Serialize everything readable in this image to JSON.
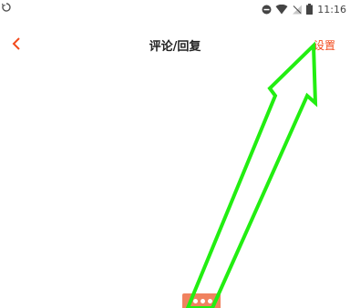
{
  "status_bar": {
    "time": "11:16",
    "icons": [
      "sync-icon",
      "do-not-disturb-icon",
      "wifi-icon",
      "signal-off-icon",
      "battery-icon"
    ]
  },
  "header": {
    "back_icon": "chevron-left-icon",
    "title": "评论/回复",
    "settings_label": "设置"
  },
  "colors": {
    "accent": "#f24a1c",
    "annotation_arrow": "#22ee11",
    "bottom_widget": "#f0825f"
  }
}
